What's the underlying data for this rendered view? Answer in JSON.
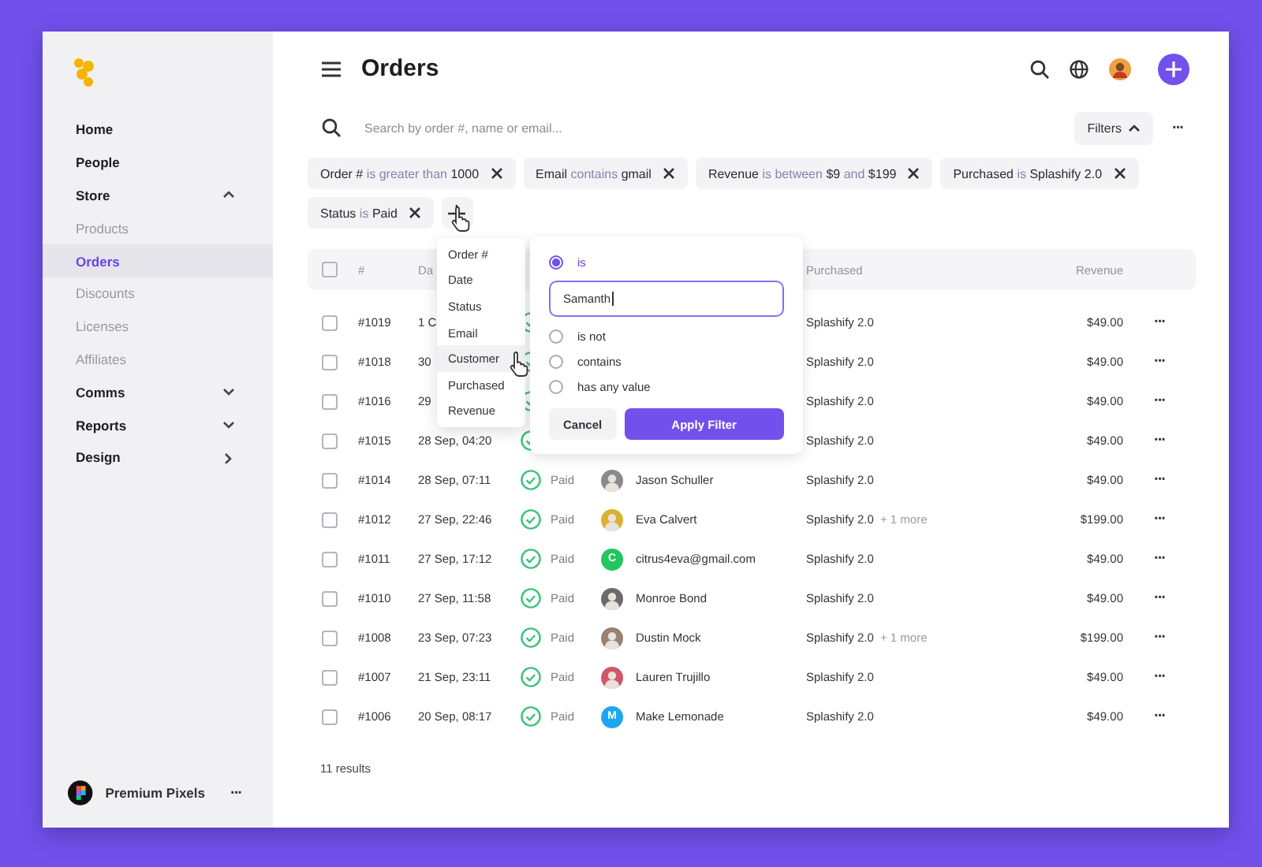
{
  "sidebar": {
    "items": [
      {
        "label": "Home",
        "kind": "page",
        "selected": false
      },
      {
        "label": "People",
        "kind": "page",
        "selected": false
      },
      {
        "label": "Store",
        "kind": "group",
        "expanded": true,
        "selected": false
      },
      {
        "label": "Products",
        "kind": "subpage",
        "selected": false
      },
      {
        "label": "Orders",
        "kind": "subpage",
        "selected": true
      },
      {
        "label": "Discounts",
        "kind": "subpage",
        "selected": false
      },
      {
        "label": "Licenses",
        "kind": "subpage",
        "selected": false
      },
      {
        "label": "Affiliates",
        "kind": "subpage",
        "selected": false
      },
      {
        "label": "Comms",
        "kind": "group",
        "expanded": false,
        "selected": false
      },
      {
        "label": "Reports",
        "kind": "group",
        "expanded": false,
        "selected": false
      },
      {
        "label": "Design",
        "kind": "link",
        "selected": false
      }
    ],
    "account": {
      "name": "Premium Pixels",
      "menu": "···"
    }
  },
  "header": {
    "title": "Orders"
  },
  "search": {
    "placeholder": "Search by order #, name or email...",
    "filters_button": "Filters",
    "filters_open": true,
    "more": "···"
  },
  "filter_chips": [
    {
      "parts": [
        {
          "text": "Order #",
          "muted": false
        },
        {
          "text": "is greater than",
          "muted": true
        },
        {
          "text": "1000",
          "muted": false
        }
      ]
    },
    {
      "parts": [
        {
          "text": "Email",
          "muted": false
        },
        {
          "text": "contains",
          "muted": true
        },
        {
          "text": "gmail",
          "muted": false
        }
      ]
    },
    {
      "parts": [
        {
          "text": "Revenue",
          "muted": false
        },
        {
          "text": "is between",
          "muted": true
        },
        {
          "text": "$9",
          "muted": false
        },
        {
          "text": "and",
          "muted": true
        },
        {
          "text": "$199",
          "muted": false
        }
      ]
    },
    {
      "parts": [
        {
          "text": "Purchased",
          "muted": false
        },
        {
          "text": "is",
          "muted": true
        },
        {
          "text": "Splashify 2.0",
          "muted": false
        }
      ]
    },
    {
      "parts": [
        {
          "text": "Status",
          "muted": false
        },
        {
          "text": "is",
          "muted": true
        },
        {
          "text": "Paid",
          "muted": false
        }
      ]
    }
  ],
  "table": {
    "header_checked": false,
    "columns": [
      "#",
      "Da",
      "Purchased",
      "Revenue"
    ],
    "rows": [
      {
        "checked": false,
        "number": "#1019",
        "date": "1 C",
        "paid": true,
        "purchased": "Splashify 2.0",
        "revenue": "$49.00",
        "menu": "···"
      },
      {
        "checked": false,
        "number": "#1018",
        "date": "30",
        "paid": true,
        "purchased": "Splashify 2.0",
        "revenue": "$49.00",
        "menu": "···"
      },
      {
        "checked": false,
        "number": "#1016",
        "date": "29",
        "paid": true,
        "purchased": "Splashify 2.0",
        "revenue": "$49.00",
        "menu": "···"
      },
      {
        "checked": false,
        "number": "#1015",
        "date": "28 Sep, 04:20",
        "paid": true,
        "purchased": "Splashify 2.0",
        "revenue": "$49.00",
        "menu": "···"
      },
      {
        "checked": false,
        "number": "#1014",
        "date": "28 Sep, 07:11",
        "paid": true,
        "status": "Paid",
        "customer": {
          "name": "Jason Schuller",
          "avatar": {
            "kind": "photo",
            "color": "#8a8a8a"
          }
        },
        "purchased": "Splashify 2.0",
        "revenue": "$49.00",
        "menu": "···"
      },
      {
        "checked": false,
        "number": "#1012",
        "date": "27 Sep, 22:46",
        "paid": true,
        "status": "Paid",
        "customer": {
          "name": "Eva Calvert",
          "avatar": {
            "kind": "photo",
            "color": "#d9b233"
          }
        },
        "purchased": "Splashify 2.0",
        "more": "+ 1 more",
        "revenue": "$199.00",
        "menu": "···"
      },
      {
        "checked": false,
        "number": "#1011",
        "date": "27 Sep, 17:12",
        "paid": true,
        "status": "Paid",
        "customer": {
          "name": "citrus4eva@gmail.com",
          "avatar": {
            "kind": "letter",
            "letter": "C",
            "color": "#22c55e"
          }
        },
        "purchased": "Splashify 2.0",
        "revenue": "$49.00",
        "menu": "···"
      },
      {
        "checked": false,
        "number": "#1010",
        "date": "27 Sep, 11:58",
        "paid": true,
        "status": "Paid",
        "customer": {
          "name": "Monroe Bond",
          "avatar": {
            "kind": "photo",
            "color": "#6b6b6b"
          }
        },
        "purchased": "Splashify 2.0",
        "revenue": "$49.00",
        "menu": "···"
      },
      {
        "checked": false,
        "number": "#1008",
        "date": "23 Sep, 07:23",
        "paid": true,
        "status": "Paid",
        "customer": {
          "name": "Dustin Mock",
          "avatar": {
            "kind": "photo",
            "color": "#9a8070"
          }
        },
        "purchased": "Splashify 2.0",
        "more": "+ 1 more",
        "revenue": "$199.00",
        "menu": "···"
      },
      {
        "checked": false,
        "number": "#1007",
        "date": "21 Sep, 23:11",
        "paid": true,
        "status": "Paid",
        "customer": {
          "name": "Lauren Trujillo",
          "avatar": {
            "kind": "photo",
            "color": "#d2566a"
          }
        },
        "purchased": "Splashify 2.0",
        "revenue": "$49.00",
        "menu": "···"
      },
      {
        "checked": false,
        "number": "#1006",
        "date": "20 Sep, 08:17",
        "paid": true,
        "status": "Paid",
        "customer": {
          "name": "Make Lemonade",
          "avatar": {
            "kind": "letter",
            "letter": "M",
            "color": "#1ea7f0"
          }
        },
        "purchased": "Splashify 2.0",
        "revenue": "$49.00",
        "menu": "···"
      }
    ],
    "results": "11 results"
  },
  "field_menu": {
    "items": [
      {
        "label": "Order #",
        "selected": false
      },
      {
        "label": "Date",
        "selected": false
      },
      {
        "label": "Status",
        "selected": false
      },
      {
        "label": "Email",
        "selected": false
      },
      {
        "label": "Customer",
        "selected": true
      },
      {
        "label": "Purchased",
        "selected": false
      },
      {
        "label": "Revenue",
        "selected": false
      }
    ]
  },
  "filter_popover": {
    "options": [
      {
        "label": "is",
        "selected": true,
        "value": "Samanth"
      },
      {
        "label": "is not",
        "selected": false
      },
      {
        "label": "contains",
        "selected": false
      },
      {
        "label": "has any value",
        "selected": false
      }
    ],
    "cancel": "Cancel",
    "apply": "Apply Filter"
  }
}
